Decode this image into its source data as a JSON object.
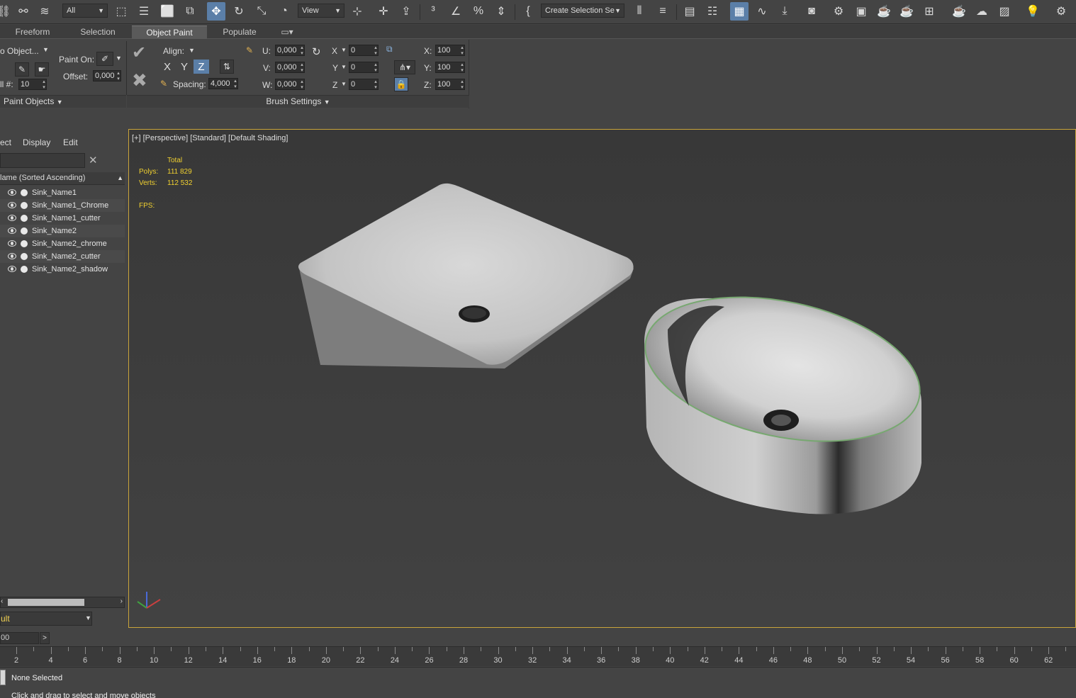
{
  "toolbar": {
    "selection_filter": "All",
    "reference_coord": "View",
    "named_selection": "Create Selection Se"
  },
  "ribbon_tabs": [
    "Freeform",
    "Selection",
    "Object Paint",
    "Populate"
  ],
  "ribbon": {
    "paint_object_label": "o Object...",
    "paint_on_label": "Paint On:",
    "offset_label": "Offset:",
    "offset_value": "0,000",
    "fill_label": "ll #:",
    "fill_value": "10",
    "align_label": "Align:",
    "axis_x": "X",
    "axis_y": "Y",
    "axis_z": "Z",
    "spacing_label": "Spacing:",
    "spacing_value": "4,000",
    "u_label": "U:",
    "u_value": "0,000",
    "v_label": "V:",
    "v_value": "0,000",
    "w_label": "W:",
    "w_value": "0,000",
    "rx_label": "X",
    "rx_value": "0",
    "ry_label": "Y",
    "ry_value": "0",
    "rz_label": "Z",
    "rz_value": "0",
    "sx_label": "X:",
    "sx_value": "100",
    "sy_label": "Y:",
    "sy_value": "100",
    "sz_label": "Z:",
    "sz_value": "100",
    "panel_paint_objects": "Paint Objects",
    "panel_brush_settings": "Brush Settings"
  },
  "explorer": {
    "menu": [
      "ect",
      "Display",
      "Edit"
    ],
    "column_header": "lame (Sorted Ascending)",
    "items": [
      "Sink_Name1",
      "Sink_Name1_Chrome",
      "Sink_Name1_cutter",
      "Sink_Name2",
      "Sink_Name2_chrome",
      "Sink_Name2_cutter",
      "Sink_Name2_shadow"
    ],
    "layer": "ult"
  },
  "viewport": {
    "label": "[+] [Perspective] [Standard] [Default Shading]",
    "stats_header": "Total",
    "polys_label": "Polys:",
    "polys_value": "111 829",
    "verts_label": "Verts:",
    "verts_value": "112 532",
    "fps_label": "FPS:"
  },
  "timeline": {
    "frame_field": "00",
    "next": ">",
    "ticks": [
      "2",
      "4",
      "6",
      "8",
      "10",
      "12",
      "14",
      "16",
      "18",
      "20",
      "22",
      "24",
      "26",
      "28",
      "30",
      "32",
      "34",
      "36",
      "38",
      "40",
      "42",
      "44",
      "46",
      "48",
      "50",
      "52",
      "54",
      "56",
      "58",
      "60",
      "62"
    ]
  },
  "status": {
    "selection": "None Selected",
    "prompt": "Click and drag to select and move objects"
  },
  "colors": {
    "accent": "#5b7fa8",
    "viewport_border": "#c9a43a",
    "stats_text": "#f0d030"
  }
}
